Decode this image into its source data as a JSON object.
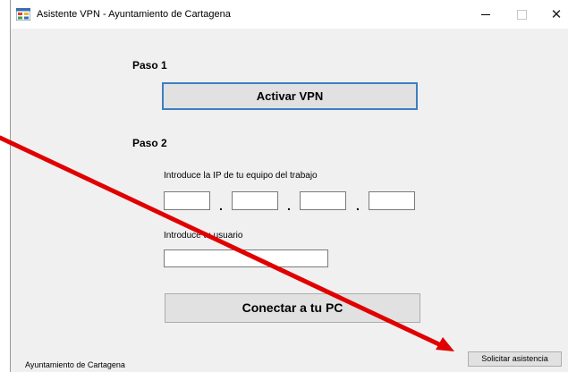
{
  "window": {
    "title": "Asistente VPN - Ayuntamiento de Cartagena",
    "app_icon": "windows-form-icon",
    "controls": [
      "minimize-icon",
      "maximize-icon",
      "close-icon"
    ],
    "close_glyph": "✕"
  },
  "step1": {
    "label": "Paso 1",
    "activate_button": "Activar VPN"
  },
  "step2": {
    "label": "Paso 2",
    "ip_label": "Introduce la IP de tu equipo del trabajo",
    "ip_octets": [
      "",
      "",
      "",
      ""
    ],
    "ip_separator": ".",
    "user_label": "Introduce tu usuario",
    "user_value": "",
    "connect_button": "Conectar a tu PC"
  },
  "footer": {
    "organization": "Ayuntamiento de Cartagena",
    "assistance_button": "Solicitar asistencia"
  },
  "colors": {
    "window_bg": "#f0f0f0",
    "button_bg": "#e1e1e1",
    "focus_border": "#3c7fc1",
    "annotation_arrow": "#e00000"
  }
}
